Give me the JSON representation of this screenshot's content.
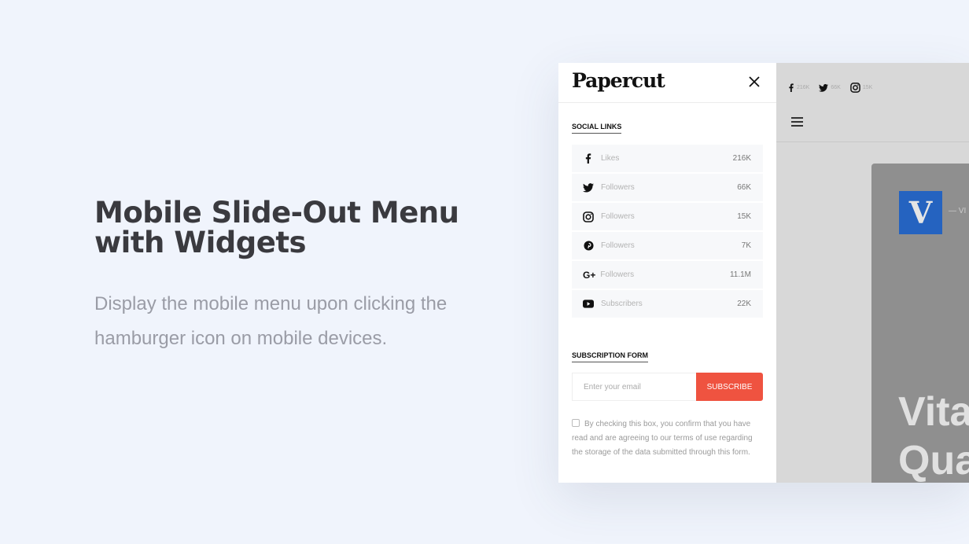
{
  "hero": {
    "title_line1": "Mobile Slide-Out Menu",
    "title_line2": "with Widgets",
    "description": "Display the mobile menu upon clicking the hamburger icon on mobile devices."
  },
  "menu": {
    "logo": "Papercut",
    "close_icon": "close-icon",
    "social_title": "SOCIAL LINKS",
    "social": [
      {
        "icon": "facebook-icon",
        "label": "Likes",
        "count": "216K"
      },
      {
        "icon": "twitter-icon",
        "label": "Followers",
        "count": "66K"
      },
      {
        "icon": "instagram-icon",
        "label": "Followers",
        "count": "15K"
      },
      {
        "icon": "pinterest-icon",
        "label": "Followers",
        "count": "7K"
      },
      {
        "icon": "google-plus-icon",
        "label": "Followers",
        "count": "11.1M"
      },
      {
        "icon": "youtube-icon",
        "label": "Subscribers",
        "count": "22K"
      }
    ],
    "subscription_title": "SUBSCRIPTION FORM",
    "email_placeholder": "Enter your email",
    "subscribe_label": "SUBSCRIBE",
    "subscribe_color": "#ef5340",
    "consent": "By checking this box, you confirm that you have read and are agreeing to our terms of use regarding the storage of the data submitted through this form."
  },
  "page": {
    "top_social": [
      {
        "icon": "facebook-icon",
        "count": "216K"
      },
      {
        "icon": "twitter-icon",
        "count": "66K"
      },
      {
        "icon": "instagram-icon",
        "count": "15K"
      }
    ],
    "card_logo": "V",
    "card_meta": "— VI",
    "headline": "Vita\nQua"
  }
}
